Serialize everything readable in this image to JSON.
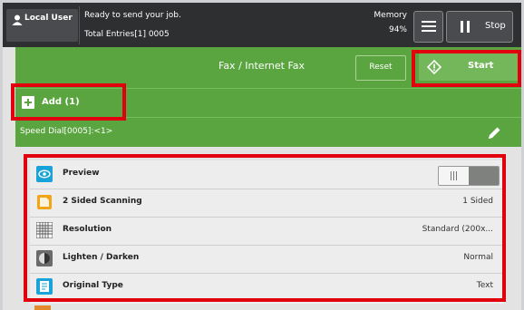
{
  "status_bar": {
    "user_label": "Local User",
    "message": "Ready to send your job.",
    "entries": "Total Entries[1] 0005",
    "memory_label": "Memory",
    "memory_value": "94%",
    "stop_label": "Stop"
  },
  "header": {
    "title": "Fax / Internet Fax",
    "reset_label": "Reset",
    "start_label": "Start"
  },
  "recipients": {
    "add_label": "Add (1)",
    "speed_dial": "Speed Dial[0005]:<1>"
  },
  "settings": [
    {
      "label": "Preview",
      "value": "",
      "icon": "eye-icon"
    },
    {
      "label": "2 Sided Scanning",
      "value": "1 Sided",
      "icon": "two-sided-icon"
    },
    {
      "label": "Resolution",
      "value": "Standard (200x...",
      "icon": "grid-icon"
    },
    {
      "label": "Lighten / Darken",
      "value": "Normal",
      "icon": "contrast-icon"
    },
    {
      "label": "Original Type",
      "value": "Text",
      "icon": "document-icon"
    }
  ],
  "colors": {
    "green": "#5aa53f",
    "dark": "#2e2f31",
    "annotation_red": "#e2000f"
  }
}
